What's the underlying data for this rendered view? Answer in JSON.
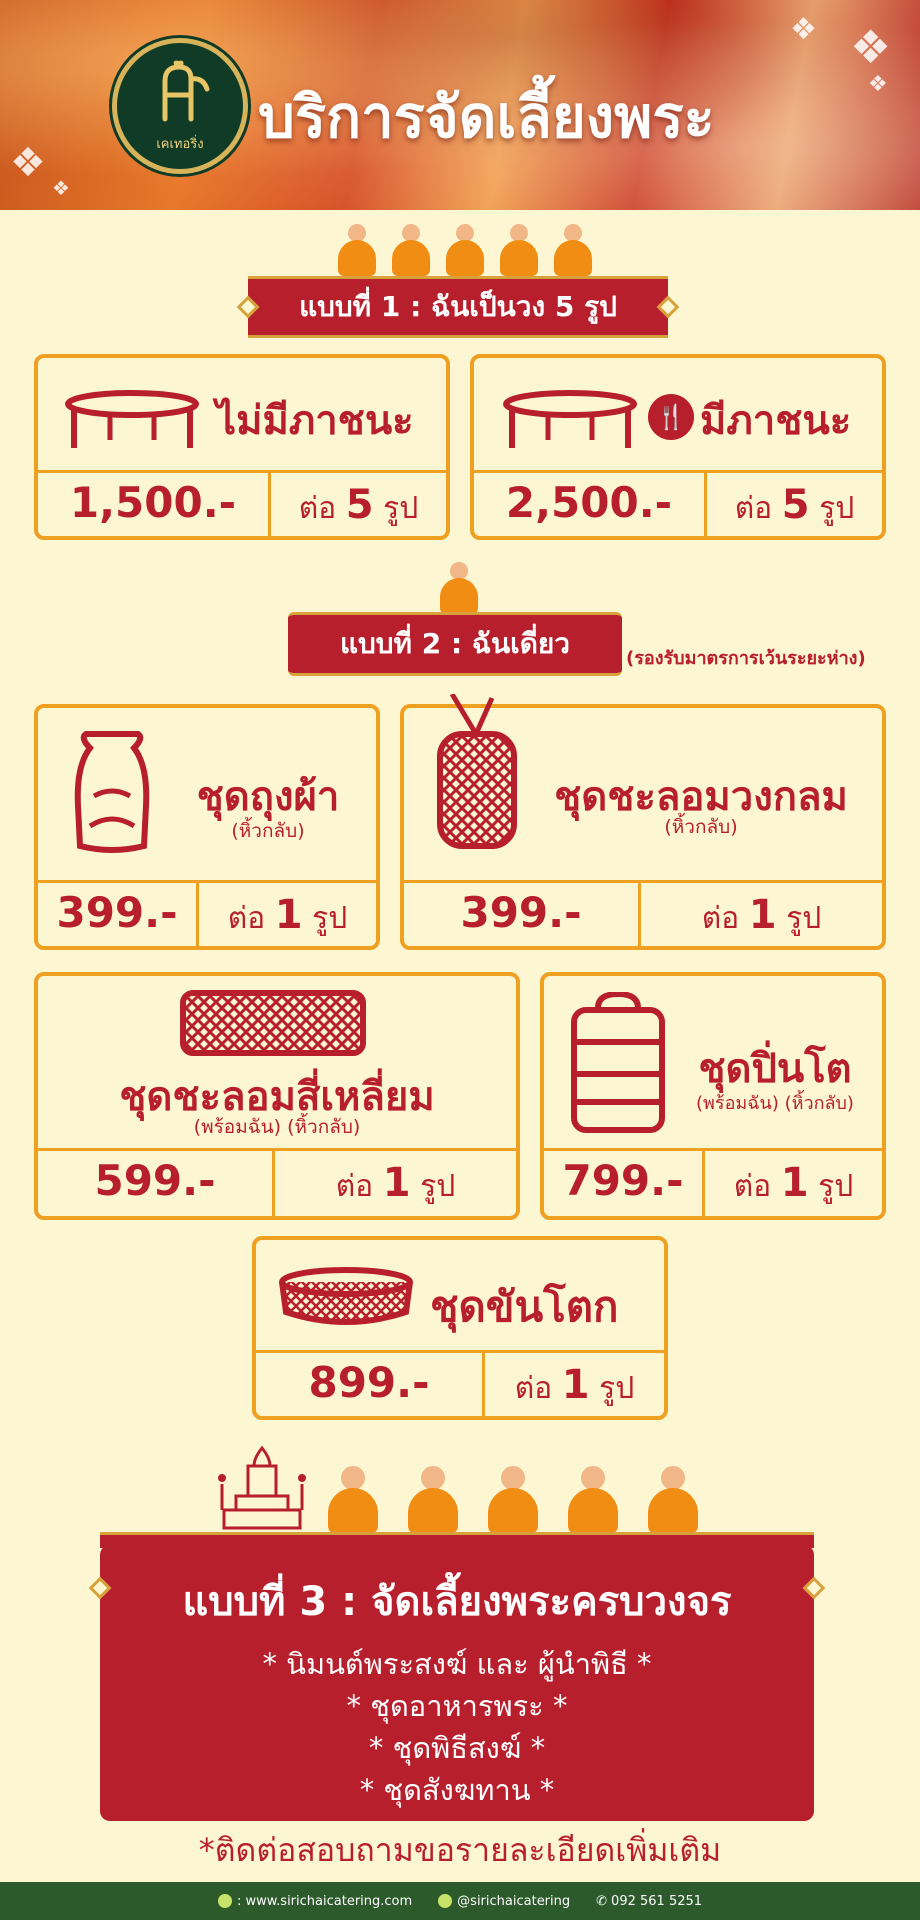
{
  "header": {
    "title": "บริการจัดเลี้ยงพระ",
    "logo_text": "เคเทอริ่ง"
  },
  "plan1": {
    "ribbon": "แบบที่ 1 : ฉันเป็นวง 5 รูป",
    "no_food": {
      "title": "ไม่มีภาชนะ",
      "price": "1,500.-",
      "per_word": "ต่อ",
      "per_num": "5",
      "per_unit": "รูป"
    },
    "with_food": {
      "title": "มีภาชนะ",
      "price": "2,500.-",
      "per_word": "ต่อ",
      "per_num": "5",
      "per_unit": "รูป"
    }
  },
  "plan2": {
    "ribbon": "แบบที่ 2 : ฉันเดี่ยว",
    "note": "(รองรับมาตรการเว้นระยะห่าง)",
    "items": [
      {
        "title": "ชุดถุงผ้า",
        "sub": "(หิ้วกลับ)",
        "price": "399.-",
        "per_word": "ต่อ",
        "per_num": "1",
        "per_unit": "รูป"
      },
      {
        "title": "ชุดชะลอมวงกลม",
        "sub": "(หิ้วกลับ)",
        "price": "399.-",
        "per_word": "ต่อ",
        "per_num": "1",
        "per_unit": "รูป"
      },
      {
        "title": "ชุดชะลอมสี่เหลี่ยม",
        "sub": "(พร้อมฉัน) (หิ้วกลับ)",
        "price": "599.-",
        "per_word": "ต่อ",
        "per_num": "1",
        "per_unit": "รูป"
      },
      {
        "title": "ชุดปิ่นโต",
        "sub": "(พร้อมฉัน) (หิ้วกลับ)",
        "price": "799.-",
        "per_word": "ต่อ",
        "per_num": "1",
        "per_unit": "รูป"
      },
      {
        "title": "ชุดขันโตก",
        "sub": "",
        "price": "899.-",
        "per_word": "ต่อ",
        "per_num": "1",
        "per_unit": "รูป"
      }
    ]
  },
  "plan3": {
    "title": "แบบที่ 3 : จัดเลี้ยงพระครบวงจร",
    "lines": [
      "* นิมนต์พระสงฆ์ และ ผู้นำพิธี *",
      "* ชุดอาหารพระ *",
      "* ชุดพิธีสงฆ์ *",
      "* ชุดสังฆทาน *"
    ]
  },
  "footnote": "*ติดต่อสอบถามขอรายละเอียดเพิ่มเติม",
  "footer": {
    "website": ": www.sirichaicatering.com",
    "line": "@sirichaicatering",
    "phone": "092 561 5251"
  },
  "colors": {
    "primary_red": "#b81f2d",
    "accent_orange": "#f0a021",
    "background": "#fdf6d3",
    "footer_green": "#2c5a2a"
  }
}
